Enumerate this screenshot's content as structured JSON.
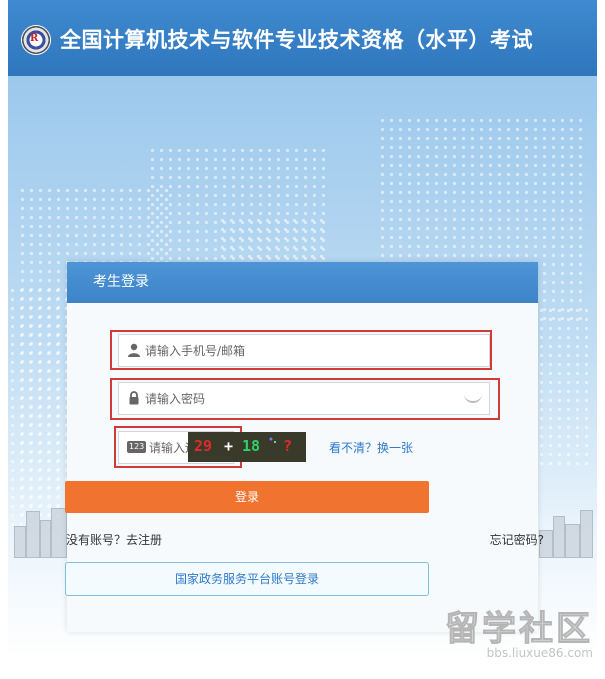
{
  "header": {
    "title": "全国计算机技术与软件专业技术资格（水平）考试",
    "logo_text": "R"
  },
  "login_panel": {
    "title": "考生登录",
    "account_placeholder": "请输入手机号/邮箱",
    "password_placeholder": "请输入密码",
    "captcha_placeholder": "请输入运算结果",
    "captcha_badge": "123",
    "captcha_text": {
      "a": "29",
      "op": "+",
      "b": "18",
      "q": "?"
    },
    "refresh_captcha_link": "看不清？换一张",
    "login_button": "登录",
    "register_link": "没有账号？去注册",
    "forgot_password_link": "忘记密码?",
    "gov_login_button": "国家政务服务平台账号登录"
  },
  "watermark": {
    "big": "留学社区",
    "small": "bbs.liuxue86.com"
  },
  "colors": {
    "header_blue": "#3581c6",
    "accent_orange": "#f07430",
    "link_blue": "#2f79c9",
    "highlight_red": "#d23a3a"
  }
}
